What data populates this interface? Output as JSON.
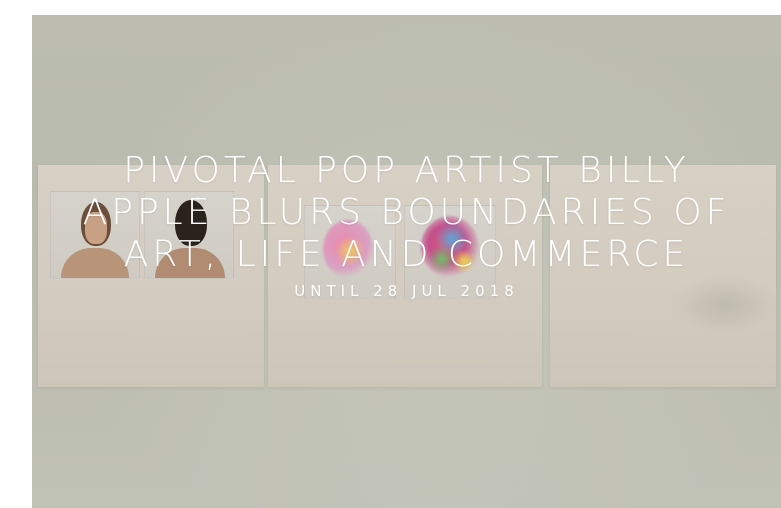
{
  "hero": {
    "title": "PIVOTAL POP ARTIST BILLY APPLE BLURS BOUNDARIES OF ART, LIFE AND COMMERCE",
    "subtitle": "UNTIL 28 JUL 2018",
    "background_color": "#c2c3b6",
    "text_color": "#ffffff"
  }
}
